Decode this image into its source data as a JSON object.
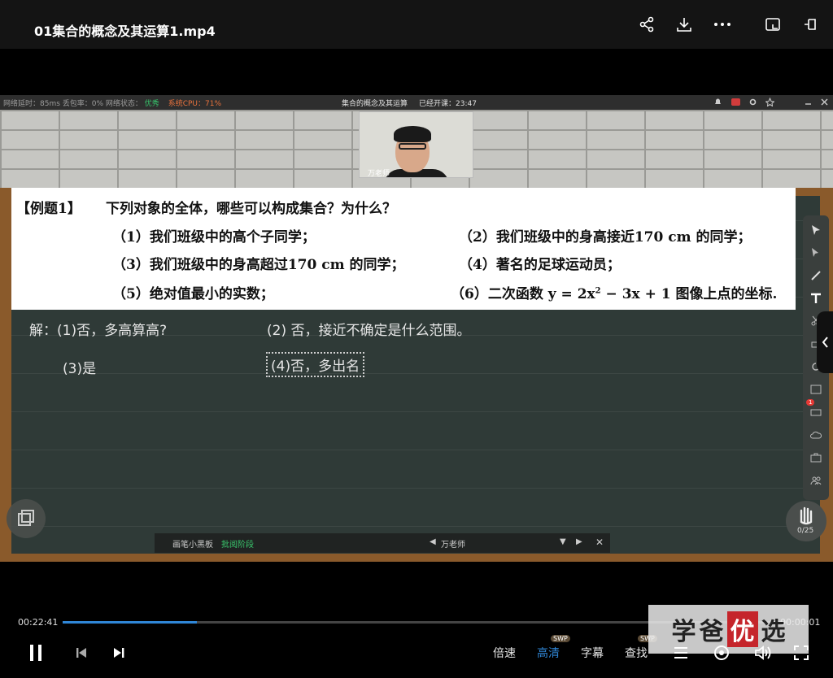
{
  "player": {
    "file_title": "01集合的概念及其运算1.mp4",
    "current_time": "00:22:41",
    "end_time": "00:00:01",
    "progress": 0.185,
    "menu": {
      "speed": "倍速",
      "quality": "高清",
      "subtitle": "字幕",
      "search": "查找",
      "swp": "SWP"
    },
    "accent_color": "#2f86d6"
  },
  "live": {
    "stats_latency": "网络延时：85ms  丢包率：0%  网络状态：",
    "network_state": "优秀",
    "cpu": "系统CPU：71%",
    "course_title": "集合的概念及其运算",
    "elapsed": "已经开课：23:47",
    "teacher_name": "万老师"
  },
  "problem": {
    "label": "【例题1】",
    "question": "下列对象的全体，哪些可以构成集合？为什么？",
    "items": [
      "（1）我们班级中的高个子同学；",
      "（2）我们班级中的身高接近170 cm 的同学；",
      "（3）我们班级中的身高超过170 cm 的同学；",
      "（4）著名的足球运动员；",
      "（5）绝对值最小的实数；",
      "（6）二次函数 y = 2x",
      "2",
      " − 3x + 1 图像上点的坐标."
    ]
  },
  "answers": {
    "a1": "解：(1)否，多高算高?",
    "a2": "(2) 否，接近不确定是什么范围。",
    "a3": "(3)是",
    "a4": "(4)否，多出名"
  },
  "board_tools": {
    "badge": "1",
    "hand_count": "0/25"
  },
  "mini_panel": {
    "tab1": "画笔小黑板",
    "tab2": "批阅阶段",
    "teacher": "万老师"
  },
  "watermark": {
    "c1": "学",
    "c2": "爸",
    "c3": "优",
    "c4": "选"
  }
}
